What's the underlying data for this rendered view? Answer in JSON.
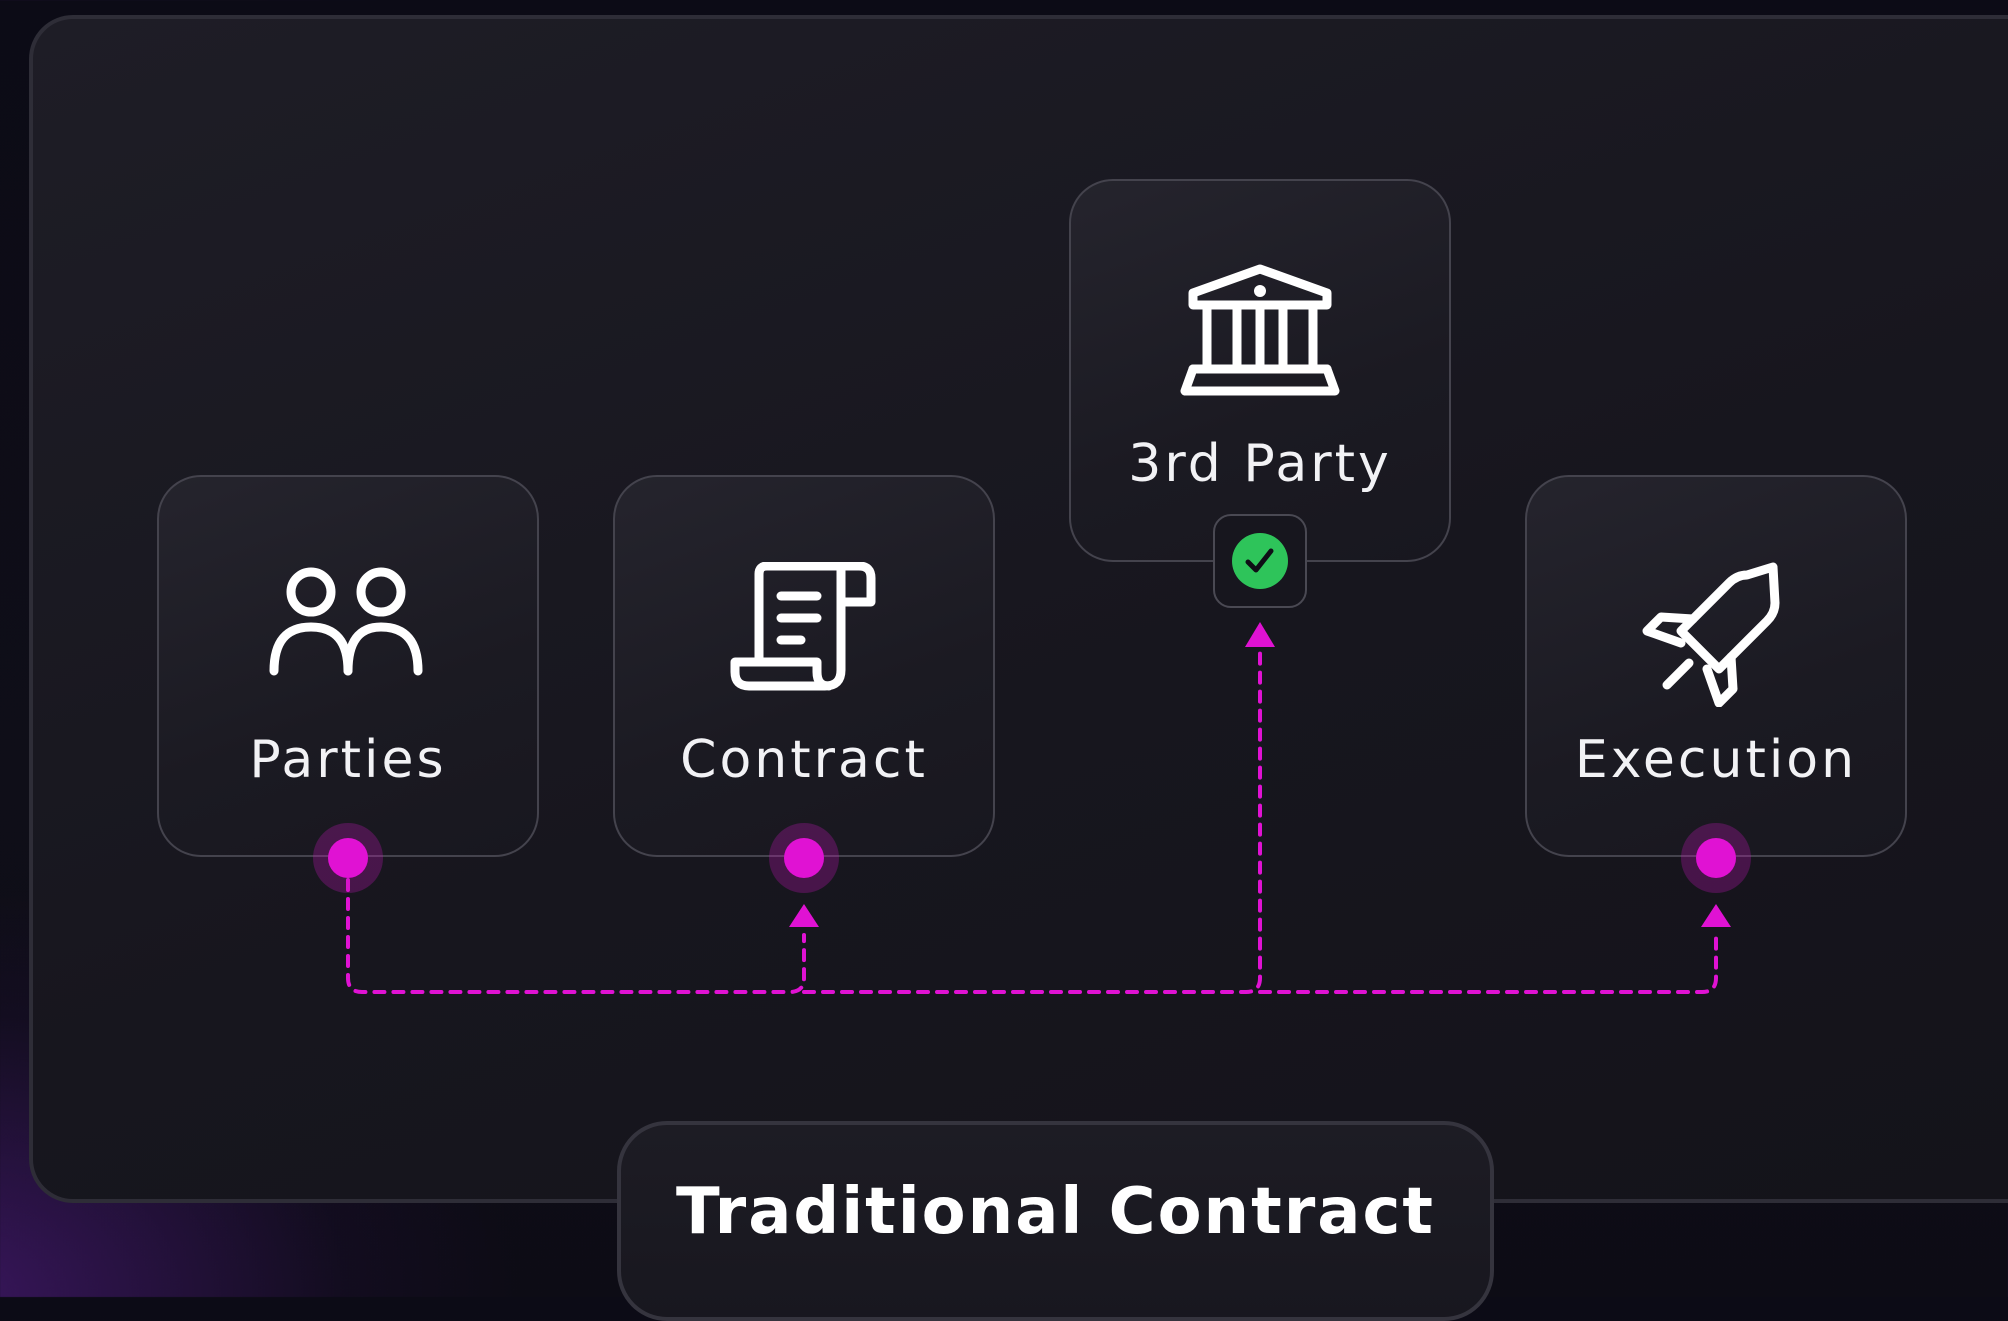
{
  "diagram": {
    "title": "Traditional Contract",
    "nodes": [
      {
        "id": "parties",
        "label": "Parties",
        "icon": "users-icon"
      },
      {
        "id": "contract",
        "label": "Contract",
        "icon": "scroll-icon"
      },
      {
        "id": "third-party",
        "label": "3rd Party",
        "icon": "bank-icon",
        "status_icon": "check-circle-icon"
      },
      {
        "id": "execution",
        "label": "Execution",
        "icon": "rocket-icon"
      }
    ],
    "connections": [
      {
        "from": "parties",
        "to": "contract",
        "style": "dashed"
      },
      {
        "from": "parties",
        "to": "third-party",
        "style": "dashed"
      },
      {
        "from": "parties",
        "to": "execution",
        "style": "dashed"
      }
    ],
    "colors": {
      "accent": "#e012d3",
      "check": "#2ec45a",
      "background": "#100f18",
      "card_border": "#44434d"
    }
  }
}
